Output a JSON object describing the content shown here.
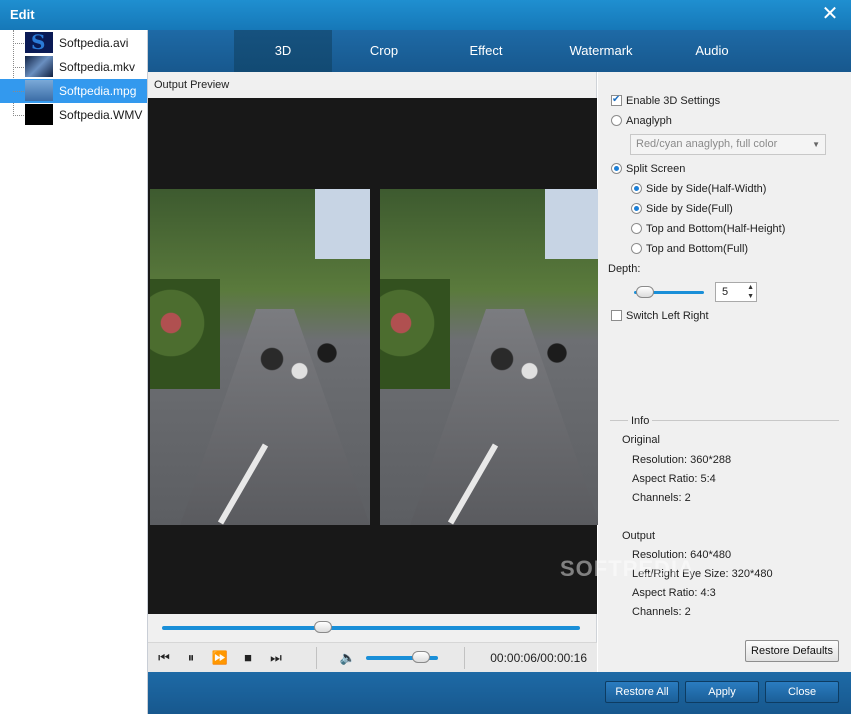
{
  "window": {
    "title": "Edit",
    "close_glyph": "✕"
  },
  "files": [
    {
      "name": "Softpedia.avi",
      "selected": false
    },
    {
      "name": "Softpedia.mkv",
      "selected": false
    },
    {
      "name": "Softpedia.mpg",
      "selected": true
    },
    {
      "name": "Softpedia.WMV",
      "selected": false
    }
  ],
  "tabs": [
    {
      "label": "3D",
      "active": true
    },
    {
      "label": "Crop",
      "active": false
    },
    {
      "label": "Effect",
      "active": false
    },
    {
      "label": "Watermark",
      "active": false
    },
    {
      "label": "Audio",
      "active": false
    }
  ],
  "preview": {
    "label": "Output Preview",
    "seek_progress": 0.38,
    "volume_level": 0.85,
    "timecode": "00:00:06/00:00:16"
  },
  "controls": {
    "prev_icon": "skip-previous-icon",
    "pause_icon": "pause-icon",
    "forward_icon": "fast-forward-icon",
    "stop_icon": "stop-icon",
    "next_icon": "skip-next-icon",
    "volume_icon": "volume-icon"
  },
  "settings": {
    "enable_3d": {
      "label": "Enable 3D Settings",
      "checked": true
    },
    "anaglyph": {
      "label": "Anaglyph",
      "checked": false
    },
    "anaglyph_mode": "Red/cyan anaglyph, full color",
    "split_screen": {
      "label": "Split Screen",
      "checked": true
    },
    "split_modes": [
      {
        "label": "Side by Side(Half-Width)",
        "checked": true
      },
      {
        "label": "Side by Side(Full)",
        "checked": true
      },
      {
        "label": "Top and Bottom(Half-Height)",
        "checked": false
      },
      {
        "label": "Top and Bottom(Full)",
        "checked": false
      }
    ],
    "depth_label": "Depth:",
    "depth_value": "5",
    "switch_lr": {
      "label": "Switch Left Right",
      "checked": false
    }
  },
  "info": {
    "title": "Info",
    "original_title": "Original",
    "original_resolution": "Resolution: 360*288",
    "original_aspect": "Aspect Ratio: 5:4",
    "original_channels": "Channels: 2",
    "output_title": "Output",
    "output_resolution": "Resolution: 640*480",
    "output_eye_size": "Left/Right Eye Size: 320*480",
    "output_aspect": "Aspect Ratio: 4:3",
    "output_channels": "Channels: 2"
  },
  "buttons": {
    "restore_defaults": "Restore Defaults",
    "restore_all": "Restore All",
    "apply": "Apply",
    "close": "Close"
  },
  "watermark_text": "SOFTPEDIA"
}
